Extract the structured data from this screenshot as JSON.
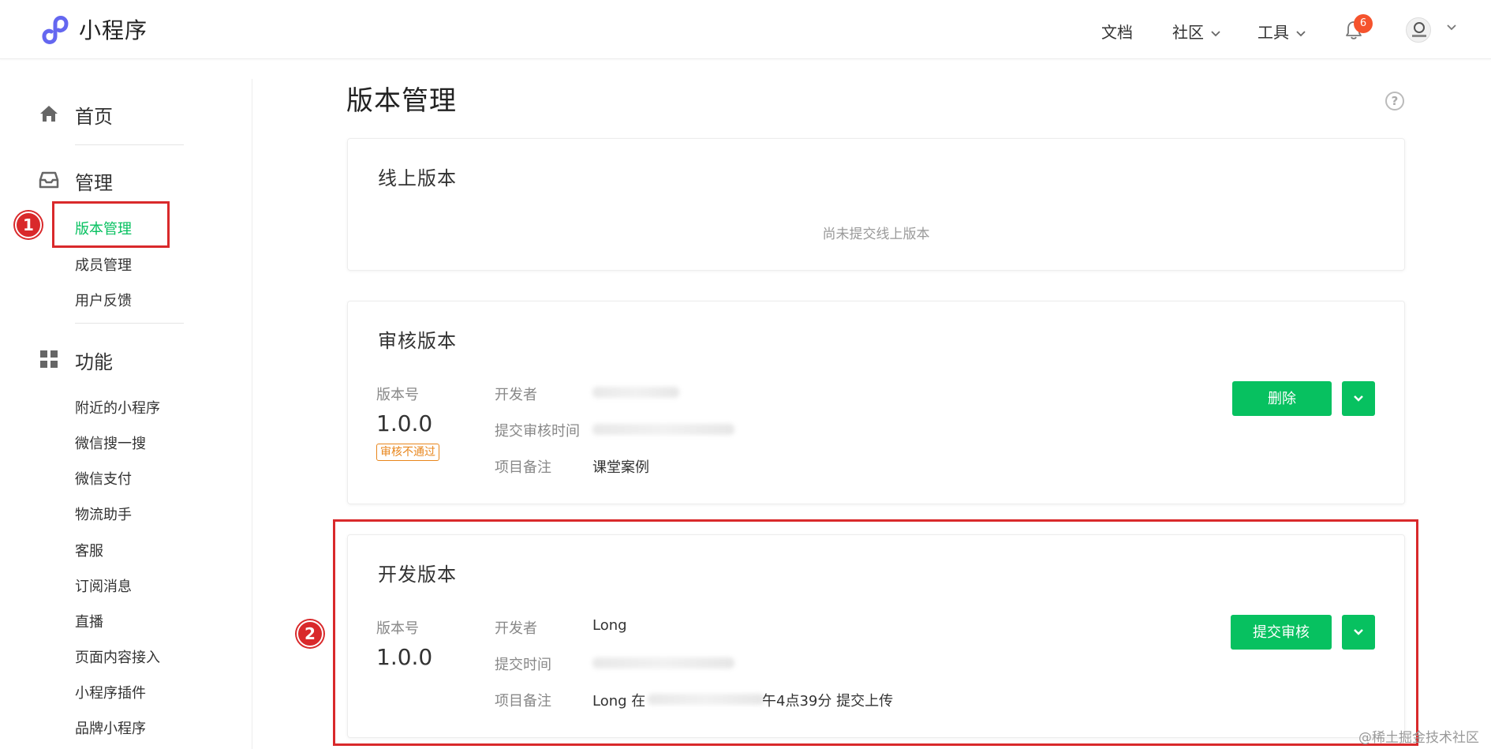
{
  "header": {
    "brand": "小程序",
    "nav": [
      {
        "label": "文档",
        "has_dropdown": false
      },
      {
        "label": "社区",
        "has_dropdown": true
      },
      {
        "label": "工具",
        "has_dropdown": true
      }
    ],
    "notification_count": "6",
    "icons": {
      "logo": "miniprogram-logo-icon",
      "bell": "bell-icon",
      "avatar": "avatar"
    }
  },
  "sidebar": {
    "home": {
      "label": "首页",
      "icon": "home-icon"
    },
    "manage": {
      "label": "管理",
      "icon": "inbox-icon",
      "items": [
        {
          "label": "版本管理",
          "active": true
        },
        {
          "label": "成员管理",
          "active": false
        },
        {
          "label": "用户反馈",
          "active": false
        }
      ]
    },
    "features": {
      "label": "功能",
      "icon": "grid-icon",
      "items": [
        {
          "label": "附近的小程序"
        },
        {
          "label": "微信搜一搜"
        },
        {
          "label": "微信支付"
        },
        {
          "label": "物流助手"
        },
        {
          "label": "客服"
        },
        {
          "label": "订阅消息"
        },
        {
          "label": "直播"
        },
        {
          "label": "页面内容接入"
        },
        {
          "label": "小程序插件"
        },
        {
          "label": "品牌小程序"
        }
      ]
    }
  },
  "annotations": {
    "step1": "1",
    "step2": "2"
  },
  "main": {
    "title": "版本管理",
    "help_icon": "?",
    "online": {
      "title": "线上版本",
      "empty_text": "尚未提交线上版本"
    },
    "review": {
      "title": "审核版本",
      "version_label": "版本号",
      "version": "1.0.0",
      "status": "审核不通过",
      "developer_label": "开发者",
      "time_label": "提交审核时间",
      "note_label": "项目备注",
      "note_value": "课堂案例",
      "delete_button": "删除"
    },
    "dev": {
      "title": "开发版本",
      "version_label": "版本号",
      "version": "1.0.0",
      "developer_label": "开发者",
      "developer_value": "Long",
      "time_label": "提交时间",
      "note_label": "项目备注",
      "note_prefix": "Long 在",
      "note_suffix": "午4点39分 提交上传",
      "submit_button": "提交审核"
    }
  },
  "watermark": "@稀土掘金技术社区",
  "colors": {
    "accent": "#07c160",
    "annotation": "#d9292b",
    "badge": "#f5532d",
    "warning": "#e8861c"
  }
}
